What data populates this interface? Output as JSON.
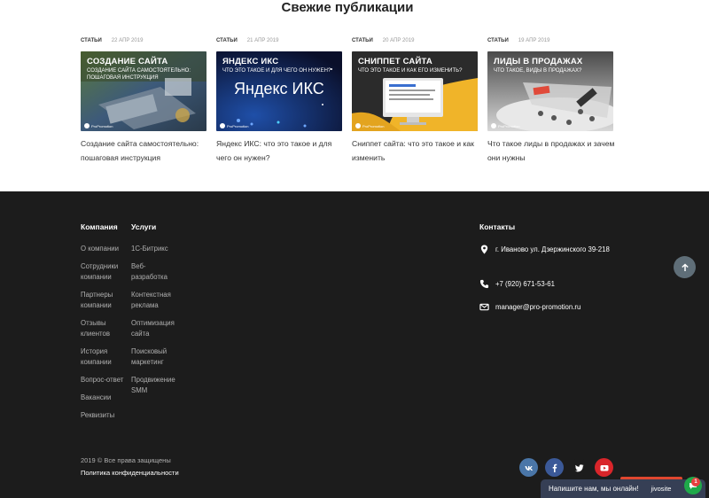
{
  "section": {
    "title": "Свежие публикации"
  },
  "articles": [
    {
      "category": "СТАТЬИ",
      "date": "22 АПР 2019",
      "thumb_title": "СОЗДАНИЕ САЙТА",
      "thumb_subtitle": "СОЗДАНИЕ САЙТА САМОСТОЯТЕЛЬНО: ПОШАГОВАЯ ИНСТРУКЦИЯ",
      "thumb_logo": "ProPromotion",
      "caption": "Создание сайта самостоятельно: пошаговая инструкция",
      "accent": "#4fa844"
    },
    {
      "category": "СТАТЬИ",
      "date": "21 АПР 2019",
      "thumb_title": "ЯНДЕКС ИКС",
      "thumb_subtitle": "ЧТО ЭТО ТАКОЕ И ДЛЯ ЧЕГО ОН НУЖЕН?",
      "thumb_big": "Яндекс ИКС",
      "thumb_logo": "ProPromotion",
      "caption": "Яндекс ИКС: что это такое и для чего он нужен?",
      "accent": "#1a2466"
    },
    {
      "category": "СТАТЬИ",
      "date": "20 АПР 2019",
      "thumb_title": "СНИППЕТ САЙТА",
      "thumb_subtitle": "ЧТО ЭТО ТАКОЕ И КАК ЕГО ИЗМЕНИТЬ?",
      "thumb_logo": "ProPromotion",
      "caption": "Сниппет сайта: что это такое и как изменить",
      "accent": "#f0b429"
    },
    {
      "category": "СТАТЬИ",
      "date": "19 АПР 2019",
      "thumb_title": "ЛИДЫ В ПРОДАЖАХ",
      "thumb_subtitle": "ЧТО ТАКОЕ, ВИДЫ В ПРОДАЖАХ?",
      "thumb_logo": "ProPromotion",
      "caption": "Что такое лиды в продажах и зачем они нужны",
      "accent": "#e04a3a"
    }
  ],
  "footer": {
    "company": {
      "title": "Компания",
      "items": [
        "О компании",
        "Сотрудники компании",
        "Партнеры компании",
        "Отзывы клиентов",
        "История компании",
        "Вопрос-ответ",
        "Вакансии",
        "Реквизиты"
      ]
    },
    "services": {
      "title": "Услуги",
      "items": [
        "1С-Битрикс",
        "Веб-разработка",
        "Контекстная реклама",
        "Оптимизация сайта",
        "Поисковый маркетинг",
        "Продвижение SMM"
      ]
    },
    "contacts": {
      "title": "Контакты",
      "address": "г. Иваново ул. Дзержинского 39-218",
      "phone": "+7 (920) 671-53-61",
      "email": "manager@pro-promotion.ru"
    },
    "copyright": "2019 © Все права защищены",
    "policy": "Политика конфиденциальности",
    "social": [
      {
        "name": "vk-icon",
        "color": "#4a76a8"
      },
      {
        "name": "facebook-icon",
        "color": "#3b5998"
      },
      {
        "name": "twitter-icon",
        "color": "#1c1c1c"
      },
      {
        "name": "youtube-icon",
        "color": "#d9252a"
      }
    ]
  },
  "chat": {
    "label": "Напишите нам, мы онлайн!",
    "brand": "jivosite",
    "badge": "1"
  }
}
